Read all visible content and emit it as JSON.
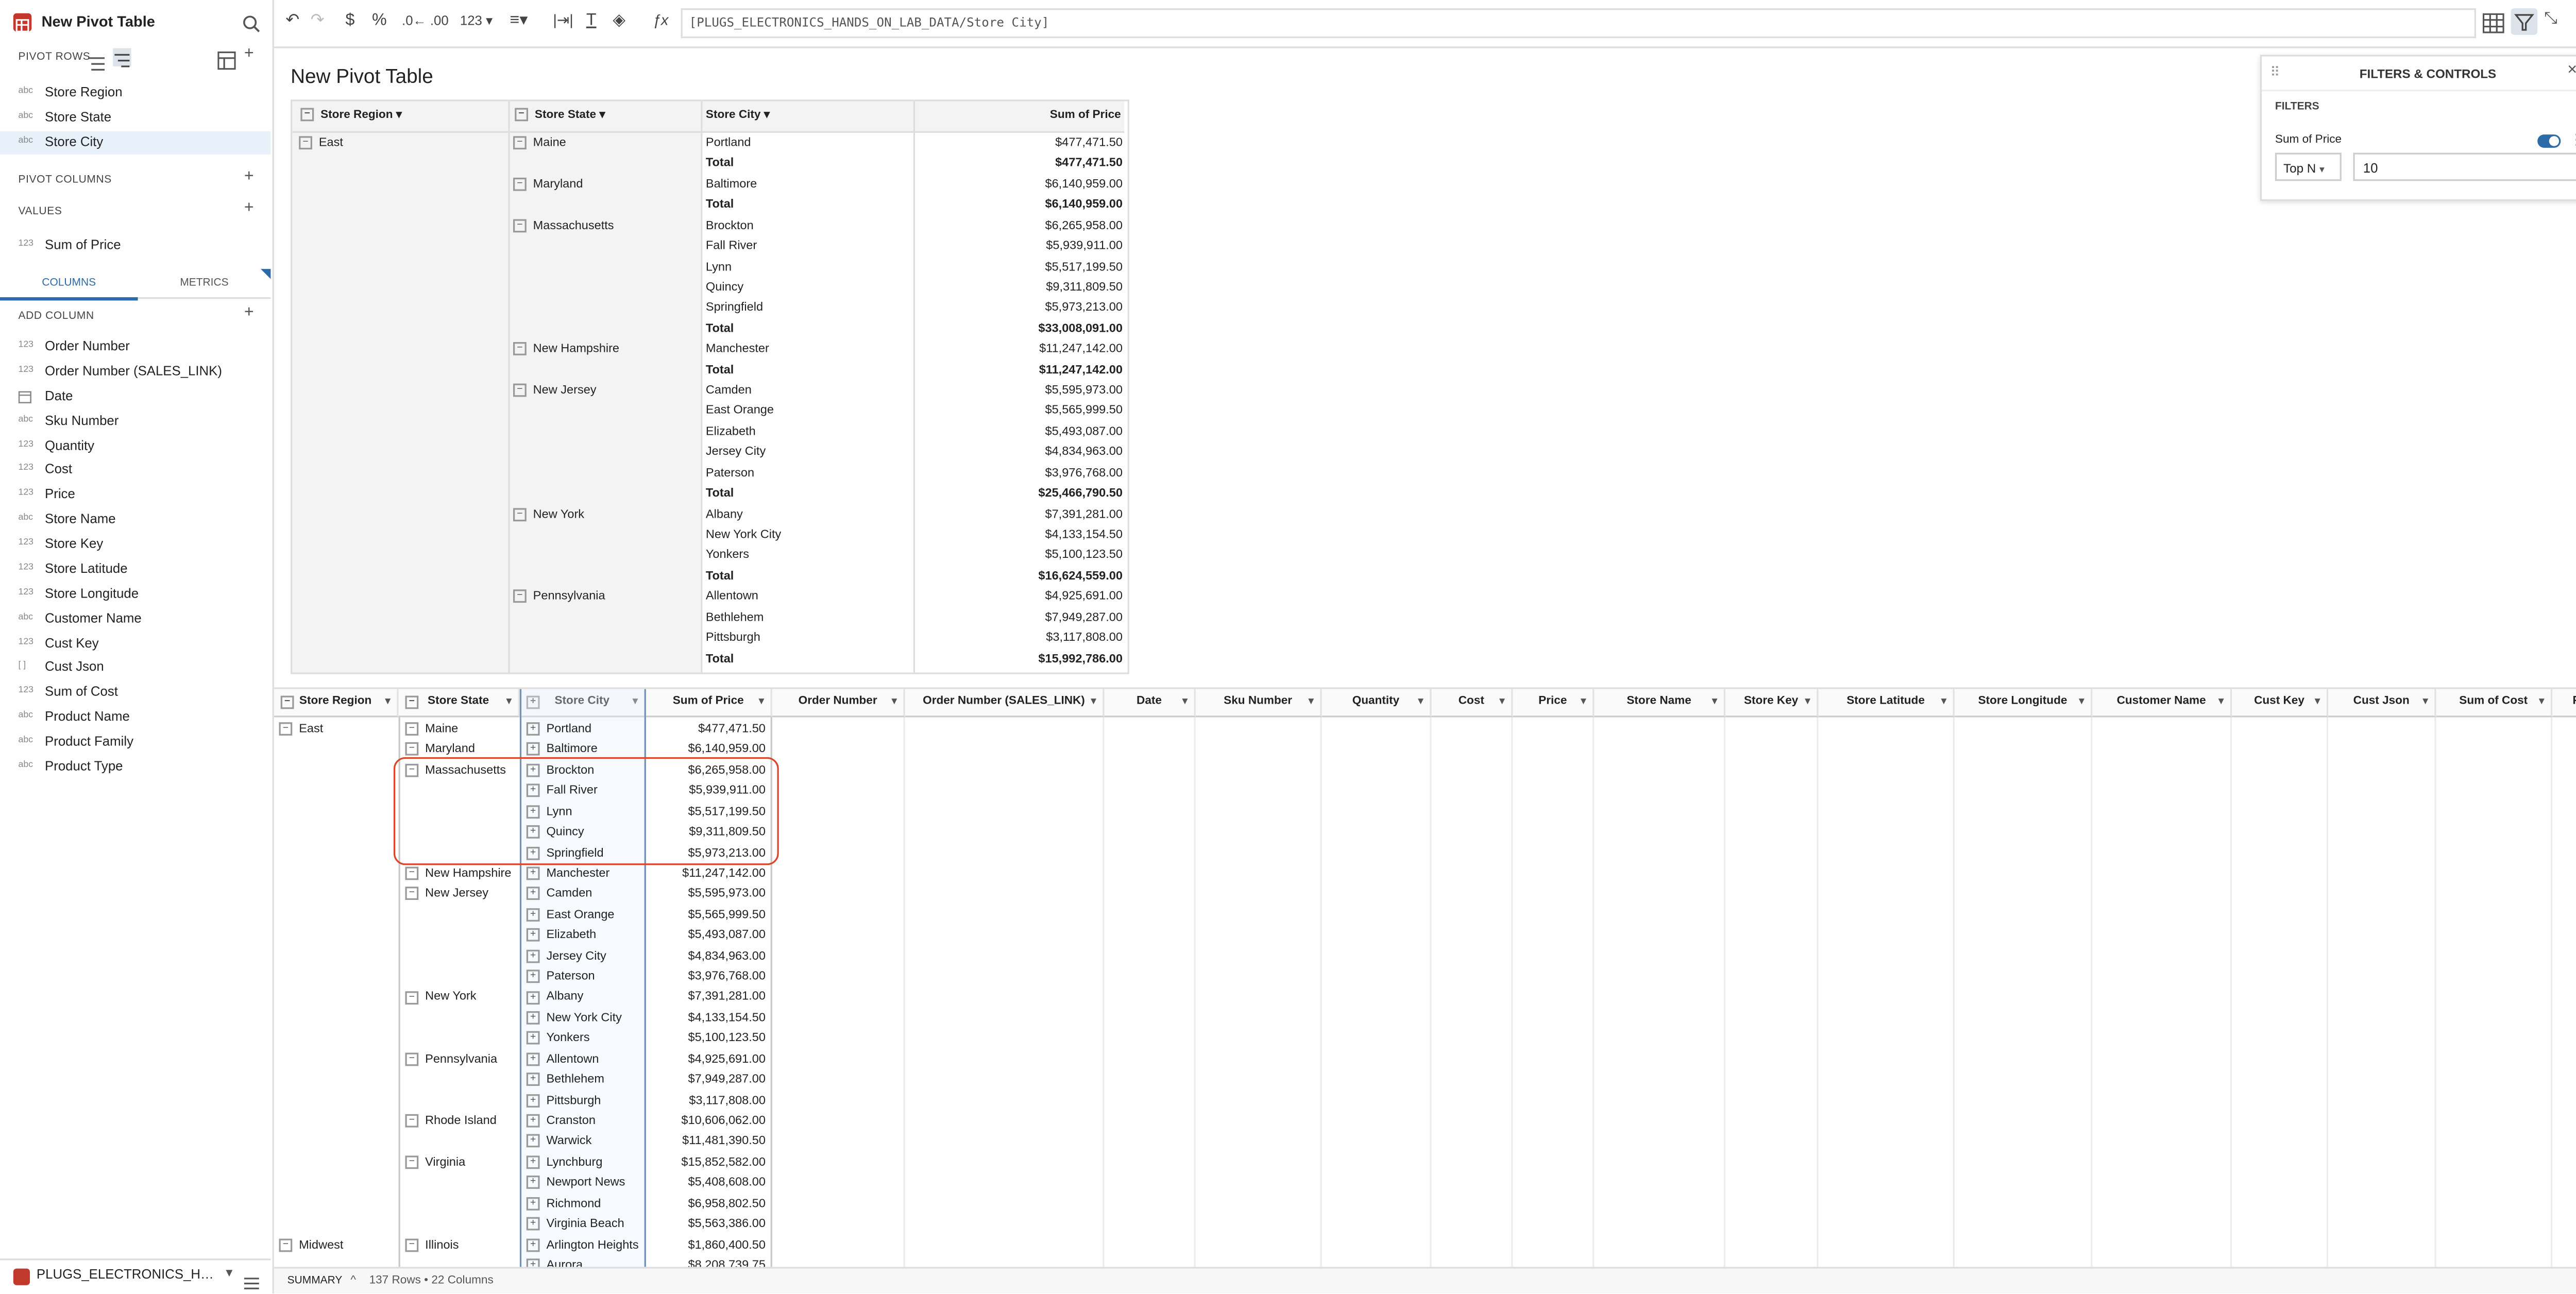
{
  "app": {
    "title": "New Pivot Table"
  },
  "sidebar": {
    "pivot_rows_label": "PIVOT ROWS",
    "pivot_rows": [
      {
        "type": "abc",
        "name": "Store Region"
      },
      {
        "type": "abc",
        "name": "Store State"
      },
      {
        "type": "abc",
        "name": "Store City"
      }
    ],
    "pivot_columns_label": "PIVOT COLUMNS",
    "values_label": "VALUES",
    "values": [
      {
        "type": "123",
        "name": "Sum of Price"
      }
    ],
    "tab_columns": "COLUMNS",
    "tab_metrics": "METRICS",
    "add_column_label": "ADD COLUMN",
    "columns": [
      {
        "type": "123",
        "name": "Order Number"
      },
      {
        "type": "123",
        "name": "Order Number (SALES_LINK)"
      },
      {
        "type": "date",
        "name": "Date"
      },
      {
        "type": "abc",
        "name": "Sku Number"
      },
      {
        "type": "123",
        "name": "Quantity"
      },
      {
        "type": "123",
        "name": "Cost"
      },
      {
        "type": "123",
        "name": "Price"
      },
      {
        "type": "abc",
        "name": "Store Name"
      },
      {
        "type": "123",
        "name": "Store Key"
      },
      {
        "type": "123",
        "name": "Store Latitude"
      },
      {
        "type": "123",
        "name": "Store Longitude"
      },
      {
        "type": "abc",
        "name": "Customer Name"
      },
      {
        "type": "123",
        "name": "Cust Key"
      },
      {
        "type": "[ ]",
        "name": "Cust Json"
      },
      {
        "type": "123",
        "name": "Sum of Cost"
      },
      {
        "type": "abc",
        "name": "Product Name"
      },
      {
        "type": "abc",
        "name": "Product Family"
      },
      {
        "type": "abc",
        "name": "Product Type"
      }
    ],
    "source_label": "PLUGS_ELECTRONICS_HAN..."
  },
  "toolbar": {
    "number_format": "123",
    "formula": "[PLUGS_ELECTRONICS_HANDS_ON_LAB_DATA/Store City]"
  },
  "pivot": {
    "title": "New Pivot Table",
    "headers": {
      "region": "Store Region",
      "state": "Store State",
      "city": "Store City",
      "value": "Sum of Price"
    },
    "region": "East",
    "total_label": "Total",
    "groups": [
      {
        "state": "Maine",
        "cities": [
          [
            "Portland",
            "$477,471.50"
          ]
        ],
        "total": "$477,471.50"
      },
      {
        "state": "Maryland",
        "cities": [
          [
            "Baltimore",
            "$6,140,959.00"
          ]
        ],
        "total": "$6,140,959.00"
      },
      {
        "state": "Massachusetts",
        "cities": [
          [
            "Brockton",
            "$6,265,958.00"
          ],
          [
            "Fall River",
            "$5,939,911.00"
          ],
          [
            "Lynn",
            "$5,517,199.50"
          ],
          [
            "Quincy",
            "$9,311,809.50"
          ],
          [
            "Springfield",
            "$5,973,213.00"
          ]
        ],
        "total": "$33,008,091.00"
      },
      {
        "state": "New Hampshire",
        "cities": [
          [
            "Manchester",
            "$11,247,142.00"
          ]
        ],
        "total": "$11,247,142.00"
      },
      {
        "state": "New Jersey",
        "cities": [
          [
            "Camden",
            "$5,595,973.00"
          ],
          [
            "East Orange",
            "$5,565,999.50"
          ],
          [
            "Elizabeth",
            "$5,493,087.00"
          ],
          [
            "Jersey City",
            "$4,834,963.00"
          ],
          [
            "Paterson",
            "$3,976,768.00"
          ]
        ],
        "total": "$25,466,790.50"
      },
      {
        "state": "New York",
        "cities": [
          [
            "Albany",
            "$7,391,281.00"
          ],
          [
            "New York City",
            "$4,133,154.50"
          ],
          [
            "Yonkers",
            "$5,100,123.50"
          ]
        ],
        "total": "$16,624,559.00"
      },
      {
        "state": "Pennsylvania",
        "cities": [
          [
            "Allentown",
            "$4,925,691.00"
          ],
          [
            "Bethlehem",
            "$7,949,287.00"
          ],
          [
            "Pittsburgh",
            "$3,117,808.00"
          ]
        ],
        "total": "$15,992,786.00"
      }
    ]
  },
  "filters": {
    "title": "FILTERS & CONTROLS",
    "section": "FILTERS",
    "filter_name": "Sum of Price",
    "mode": "Top N",
    "value": "10"
  },
  "table": {
    "headers": [
      "Store Region",
      "Store State",
      "Store City",
      "Sum of Price",
      "Order Number",
      "Order Number (SALES_LINK)",
      "Date",
      "Sku Number",
      "Quantity",
      "Cost",
      "Price",
      "Store Name",
      "Store Key",
      "Store Latitude",
      "Store Longitude",
      "Customer Name",
      "Cust Key",
      "Cust Json",
      "Sum of Cost",
      "P"
    ],
    "rows": [
      {
        "region": "East",
        "state": "Maine",
        "city": "Portland",
        "value": "$477,471.50"
      },
      {
        "region": "",
        "state": "Maryland",
        "city": "Baltimore",
        "value": "$6,140,959.00"
      },
      {
        "region": "",
        "state": "Massachusetts",
        "city": "Brockton",
        "value": "$6,265,958.00"
      },
      {
        "region": "",
        "state": "",
        "city": "Fall River",
        "value": "$5,939,911.00"
      },
      {
        "region": "",
        "state": "",
        "city": "Lynn",
        "value": "$5,517,199.50"
      },
      {
        "region": "",
        "state": "",
        "city": "Quincy",
        "value": "$9,311,809.50"
      },
      {
        "region": "",
        "state": "",
        "city": "Springfield",
        "value": "$5,973,213.00"
      },
      {
        "region": "",
        "state": "New Hampshire",
        "city": "Manchester",
        "value": "$11,247,142.00"
      },
      {
        "region": "",
        "state": "New Jersey",
        "city": "Camden",
        "value": "$5,595,973.00"
      },
      {
        "region": "",
        "state": "",
        "city": "East Orange",
        "value": "$5,565,999.50"
      },
      {
        "region": "",
        "state": "",
        "city": "Elizabeth",
        "value": "$5,493,087.00"
      },
      {
        "region": "",
        "state": "",
        "city": "Jersey City",
        "value": "$4,834,963.00"
      },
      {
        "region": "",
        "state": "",
        "city": "Paterson",
        "value": "$3,976,768.00"
      },
      {
        "region": "",
        "state": "New York",
        "city": "Albany",
        "value": "$7,391,281.00"
      },
      {
        "region": "",
        "state": "",
        "city": "New York City",
        "value": "$4,133,154.50"
      },
      {
        "region": "",
        "state": "",
        "city": "Yonkers",
        "value": "$5,100,123.50"
      },
      {
        "region": "",
        "state": "Pennsylvania",
        "city": "Allentown",
        "value": "$4,925,691.00"
      },
      {
        "region": "",
        "state": "",
        "city": "Bethlehem",
        "value": "$7,949,287.00"
      },
      {
        "region": "",
        "state": "",
        "city": "Pittsburgh",
        "value": "$3,117,808.00"
      },
      {
        "region": "",
        "state": "Rhode Island",
        "city": "Cranston",
        "value": "$10,606,062.00"
      },
      {
        "region": "",
        "state": "",
        "city": "Warwick",
        "value": "$11,481,390.50"
      },
      {
        "region": "",
        "state": "Virginia",
        "city": "Lynchburg",
        "value": "$15,852,582.00"
      },
      {
        "region": "",
        "state": "",
        "city": "Newport News",
        "value": "$5,408,608.00"
      },
      {
        "region": "",
        "state": "",
        "city": "Richmond",
        "value": "$6,958,802.50"
      },
      {
        "region": "",
        "state": "",
        "city": "Virginia Beach",
        "value": "$5,563,386.00"
      },
      {
        "region": "Midwest",
        "state": "Illinois",
        "city": "Arlington Heights",
        "value": "$1,860,400.50"
      },
      {
        "region": "",
        "state": "",
        "city": "Aurora",
        "value": "$8,208,739.75"
      }
    ]
  },
  "footer": {
    "summary": "SUMMARY",
    "counts": "137 Rows • 22 Columns"
  },
  "colors": {
    "accent": "#2d6aa8",
    "highlight": "#d9462b",
    "selection_bg": "#e8f0fa",
    "header_bg": "#f3f3f3"
  }
}
